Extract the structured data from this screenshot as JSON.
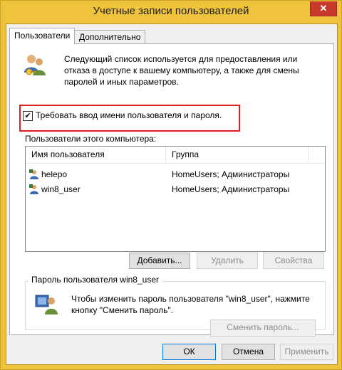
{
  "window": {
    "title": "Учетные записи пользователей",
    "close_label": "✕"
  },
  "tabs": [
    {
      "label": "Пользователи",
      "active": true
    },
    {
      "label": "Дополнительно",
      "active": false
    }
  ],
  "intro_text": "Следующий список используется для предоставления или отказа в доступе к вашему компьютеру, а также для смены паролей и иных параметров.",
  "require_login": {
    "label": "Требовать ввод имени пользователя и пароля.",
    "checked_glyph": "✔"
  },
  "users_list": {
    "label": "Пользователи этого компьютера:",
    "columns": [
      "Имя пользователя",
      "Группа"
    ],
    "rows": [
      {
        "name": "helepo",
        "group": "HomeUsers; Администраторы"
      },
      {
        "name": "win8_user",
        "group": "HomeUsers; Администраторы"
      }
    ]
  },
  "list_buttons": {
    "add": "Добавить...",
    "remove": "Удалить",
    "properties": "Свойства"
  },
  "password_group": {
    "title": "Пароль пользователя win8_user",
    "text": "Чтобы изменить пароль пользователя \"win8_user\", нажмите кнопку \"Сменить пароль\".",
    "button": "Сменить пароль..."
  },
  "dialog_buttons": {
    "ok": "ОК",
    "cancel": "Отмена",
    "apply": "Применить"
  },
  "colors": {
    "window_frame": "#f0c33c",
    "close_button": "#c7392b",
    "highlight_border": "#e02020"
  }
}
